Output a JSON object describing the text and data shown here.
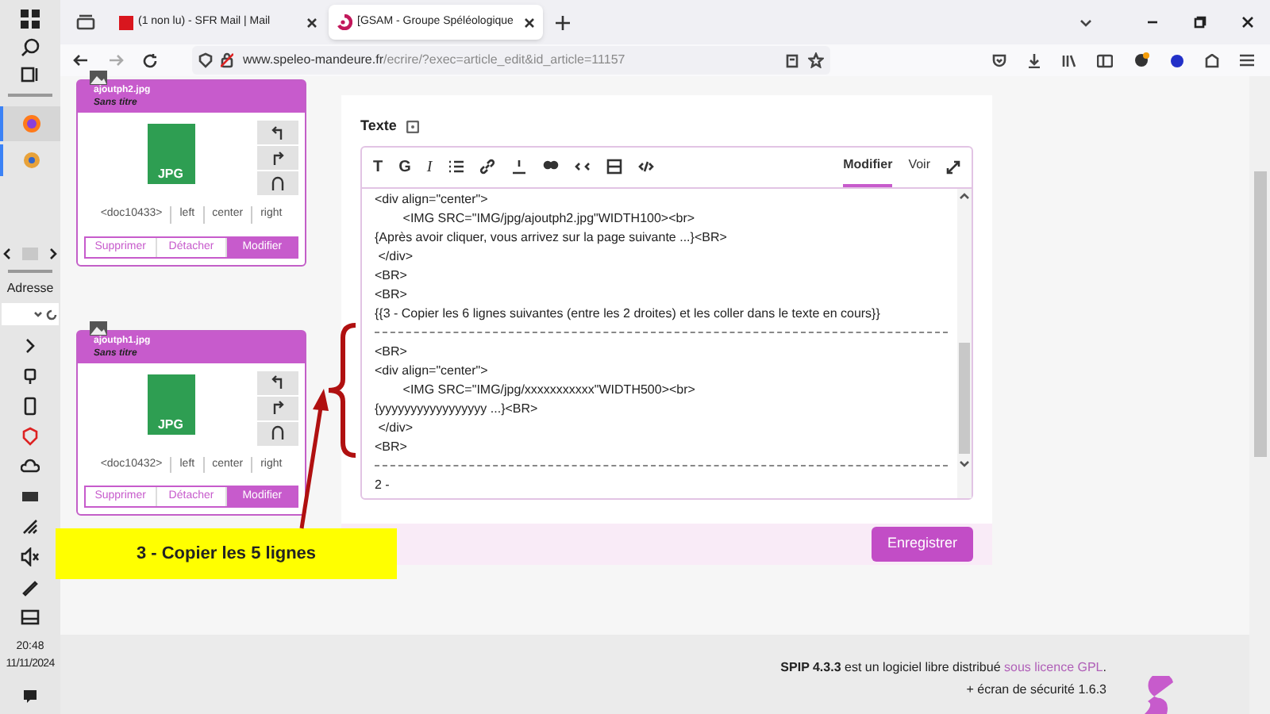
{
  "taskbar": {
    "address_label": "Adresse",
    "time": "20:48",
    "date": "11/11/2024"
  },
  "browser": {
    "tabs": [
      {
        "label": "(1 non lu) - SFR Mail | Mail",
        "selected": false
      },
      {
        "label": "[GSAM - Groupe Spéléologique",
        "selected": true
      }
    ],
    "url_host": "www.speleo-mandeure.fr",
    "url_path": "/ecrire/?exec=article_edit&id_article=11157"
  },
  "documents": [
    {
      "filename": "ajoutph2.jpg",
      "subtitle": "Sans titre",
      "file_type": "JPG",
      "code": "<doc10433>",
      "alignments": [
        "left",
        "center",
        "right"
      ],
      "buttons": [
        {
          "label": "Supprimer",
          "primary": false
        },
        {
          "label": "Détacher",
          "primary": false
        },
        {
          "label": "Modifier",
          "primary": true
        }
      ]
    },
    {
      "filename": "ajoutph1.jpg",
      "subtitle": "Sans titre",
      "file_type": "JPG",
      "code": "<doc10432>",
      "alignments": [
        "left",
        "center",
        "right"
      ],
      "buttons": [
        {
          "label": "Supprimer",
          "primary": false
        },
        {
          "label": "Détacher",
          "primary": false
        },
        {
          "label": "Modifier",
          "primary": true
        }
      ]
    }
  ],
  "editor": {
    "label": "Texte",
    "format_buttons": [
      "T",
      "G",
      "I"
    ],
    "modes": [
      {
        "label": "Modifier",
        "selected": true
      },
      {
        "label": "Voir",
        "selected": false
      }
    ],
    "lines": [
      {
        "kind": "text",
        "text": "<div align=\"center\">"
      },
      {
        "kind": "text",
        "text": "        <IMG SRC=\"IMG/jpg/ajoutph2.jpg\"WIDTH100><br>"
      },
      {
        "kind": "text",
        "text": "{Après avoir cliquer, vous arrivez sur la page suivante ...}<BR>"
      },
      {
        "kind": "text",
        "text": " </div>"
      },
      {
        "kind": "text",
        "text": "<BR>"
      },
      {
        "kind": "text",
        "text": "<BR>"
      },
      {
        "kind": "text",
        "text": "{{3 - Copier les 6 lignes suivantes (entre les 2 droites) et les coller dans le texte en cours}}"
      },
      {
        "kind": "rule"
      },
      {
        "kind": "text",
        "text": "<BR>"
      },
      {
        "kind": "text",
        "text": "<div align=\"center\">"
      },
      {
        "kind": "text",
        "text": "        <IMG SRC=\"IMG/jpg/xxxxxxxxxxx\"WIDTH500><br>"
      },
      {
        "kind": "text",
        "text": "{yyyyyyyyyyyyyyyyy ...}<BR>"
      },
      {
        "kind": "text",
        "text": " </div>"
      },
      {
        "kind": "text",
        "text": "<BR>"
      },
      {
        "kind": "rule"
      },
      {
        "kind": "text",
        "text": "2 -"
      }
    ],
    "save_button": "Enregistrer"
  },
  "footer": {
    "line_1": "**SPIP 4.3.3** est un logiciel libre distribué",
    "license_link": "sous licence GPL",
    "line_1_end": ".",
    "line_2": "+ écran de sécurité 1.6.3"
  },
  "annotation": {
    "text": "3 - Copier les 5 lignes"
  }
}
